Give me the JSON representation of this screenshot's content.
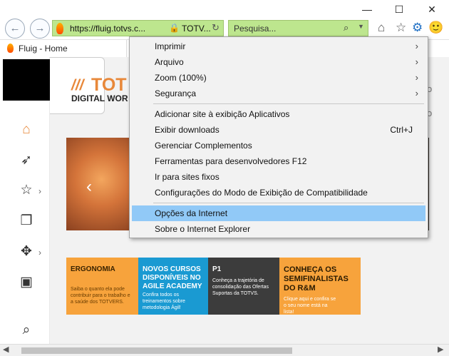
{
  "browser": {
    "window_controls": {
      "minimize": "—",
      "maximize": "☐",
      "close": "✕"
    },
    "nav": {
      "back": "←",
      "forward": "→"
    },
    "address": {
      "url": "https://fluig.totvs.c...",
      "site": "TOTV...",
      "lock": "🔒",
      "refresh": "↻"
    },
    "search": {
      "placeholder": "Pesquisa...",
      "icon": "⌕",
      "dropdown": "▼"
    },
    "tools": {
      "home": "⌂",
      "favorites": "☆",
      "settings": "⚙",
      "feedback": "🙂"
    },
    "tab": {
      "title": "Fluig - Home"
    }
  },
  "page": {
    "logo": {
      "slashes": "///",
      "title": "TOT",
      "subtitle": "DIGITAL WOR"
    },
    "rail": {
      "home": "⌂",
      "rocket": "➶",
      "star": "☆",
      "docs": "❐",
      "move": "✥",
      "screen": "▣",
      "search": "⌕",
      "chevron": "›"
    },
    "hero_prev": "‹",
    "right_partial": [
      "o",
      "o"
    ],
    "cards": [
      {
        "title": "ERGONOMIA",
        "text": "Saiba o quanto ela pode contribuir para o trabalho e a saúde dos TOTVERS."
      },
      {
        "title": "NOVOS CURSOS DISPONÍVEIS NO AGILE ACADEMY",
        "text": "Confira todos os treinamentos sobre metodologia Ágil!"
      },
      {
        "title": "P1",
        "text": "Conheça a trajetória de consolidação das Ofertas Suportas da TOTVS."
      },
      {
        "title": "CONHEÇA OS SEMIFINALISTAS DO R&M",
        "text": "Clique aqui e confira se o seu nome está na lista!"
      }
    ]
  },
  "menu": {
    "items": [
      {
        "label": "Imprimir",
        "submenu": "›"
      },
      {
        "label": "Arquivo",
        "submenu": "›"
      },
      {
        "label": "Zoom (100%)",
        "submenu": "›"
      },
      {
        "label": "Segurança",
        "submenu": "›"
      },
      {
        "label": "Adicionar site à exibição Aplicativos"
      },
      {
        "label": "Exibir downloads",
        "shortcut": "Ctrl+J"
      },
      {
        "label": "Gerenciar Complementos"
      },
      {
        "label": "Ferramentas para desenvolvedores F12"
      },
      {
        "label": "Ir para sites fixos"
      },
      {
        "label": "Configurações do Modo de Exibição de Compatibilidade"
      },
      {
        "label": "Opções da Internet"
      },
      {
        "label": "Sobre o Internet Explorer"
      }
    ]
  },
  "scrollbar": {
    "left": "◀",
    "right": "▶"
  }
}
